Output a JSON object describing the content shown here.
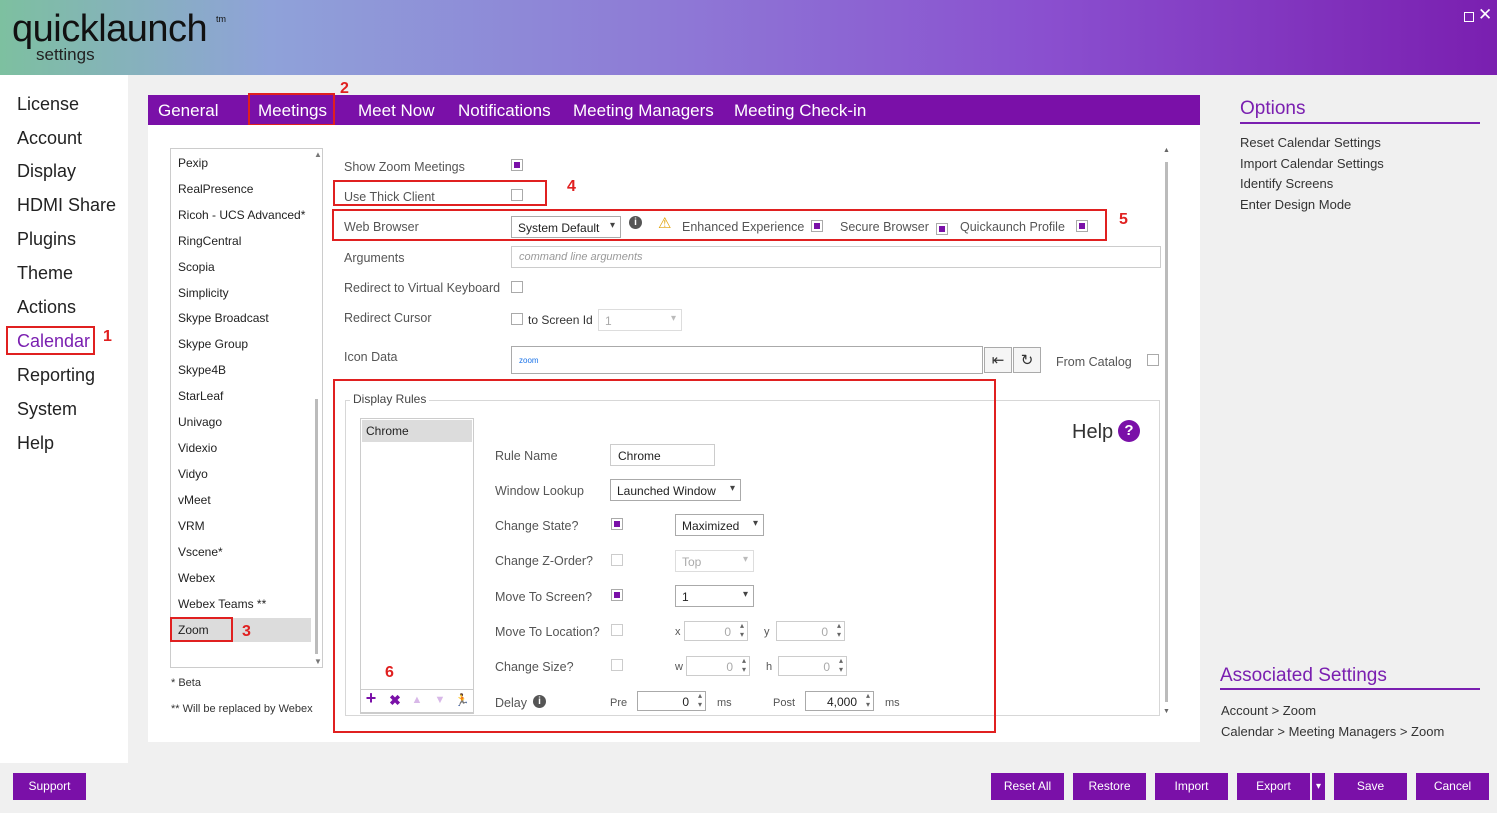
{
  "app": {
    "logo": "quicklaunch",
    "logo_tm": "tm",
    "logo_sub": "settings"
  },
  "window": {
    "maximize_icon": "maximize-icon",
    "close_icon": "close-icon",
    "close_glyph": "✕"
  },
  "nav": {
    "items": [
      {
        "label": "License"
      },
      {
        "label": "Account"
      },
      {
        "label": "Display"
      },
      {
        "label": "HDMI Share"
      },
      {
        "label": "Plugins"
      },
      {
        "label": "Theme"
      },
      {
        "label": "Actions"
      },
      {
        "label": "Calendar"
      },
      {
        "label": "Reporting"
      },
      {
        "label": "System"
      },
      {
        "label": "Help"
      }
    ],
    "active": "Calendar"
  },
  "tabs": [
    {
      "label": "General"
    },
    {
      "label": "Meetings"
    },
    {
      "label": "Meet Now"
    },
    {
      "label": "Notifications"
    },
    {
      "label": "Meeting Managers"
    },
    {
      "label": "Meeting Check-in"
    }
  ],
  "providers": {
    "items": [
      "Pexip",
      "RealPresence",
      "Ricoh - UCS Advanced*",
      "RingCentral",
      "Scopia",
      "Simplicity",
      "Skype Broadcast",
      "Skype Group",
      "Skype4B",
      "StarLeaf",
      "Univago",
      "Videxio",
      "Vidyo",
      "vMeet",
      "VRM",
      "Vscene*",
      "Webex",
      "Webex Teams **",
      "Zoom"
    ],
    "selected": "Zoom",
    "notes": {
      "beta": "* Beta",
      "replaced": "** Will be replaced by Webex"
    }
  },
  "form": {
    "show_zoom_meetings": {
      "label": "Show Zoom Meetings",
      "checked": true
    },
    "use_thick_client": {
      "label": "Use Thick Client",
      "checked": false
    },
    "web_browser": {
      "label": "Web Browser",
      "value": "System Default"
    },
    "enhanced_experience": {
      "label": "Enhanced Experience",
      "checked": true
    },
    "secure_browser": {
      "label": "Secure Browser",
      "checked": true
    },
    "quicklaunch_profile": {
      "label": "Quickaunch Profile",
      "checked": true
    },
    "arguments": {
      "label": "Arguments",
      "placeholder": "command line arguments"
    },
    "redirect_keyboard": {
      "label": "Redirect to Virtual Keyboard",
      "checked": false
    },
    "redirect_cursor": {
      "label": "Redirect Cursor",
      "to_screen_label": "to Screen Id",
      "screen_value": "1"
    },
    "icon_data": {
      "label": "Icon Data",
      "value": "zoom"
    },
    "from_catalog": {
      "label": "From Catalog",
      "checked": false
    }
  },
  "display_rules": {
    "title": "Display Rules",
    "rules": [
      "Chrome"
    ],
    "rule_name": {
      "label": "Rule Name",
      "value": "Chrome"
    },
    "window_lookup": {
      "label": "Window Lookup",
      "value": "Launched Window"
    },
    "change_state": {
      "label": "Change State?",
      "checked": true,
      "value": "Maximized"
    },
    "change_z": {
      "label": "Change Z-Order?",
      "checked": false,
      "value": "Top"
    },
    "move_screen": {
      "label": "Move To Screen?",
      "checked": true,
      "value": "1"
    },
    "move_location": {
      "label": "Move To Location?",
      "checked": false,
      "x_label": "x",
      "x": "0",
      "y_label": "y",
      "y": "0"
    },
    "change_size": {
      "label": "Change Size?",
      "checked": false,
      "w_label": "w",
      "w": "0",
      "h_label": "h",
      "h": "0"
    },
    "delay": {
      "label": "Delay",
      "pre_label": "Pre",
      "pre": "0",
      "post_label": "Post",
      "post": "4,000",
      "unit": "ms"
    },
    "tools": {
      "add": "+",
      "remove": "✖",
      "up": "▲",
      "down": "▼",
      "run": "🏃"
    }
  },
  "help": {
    "label": "Help",
    "glyph": "?"
  },
  "options": {
    "title": "Options",
    "items": [
      "Reset Calendar Settings",
      "Import Calendar Settings",
      "Identify Screens",
      "Enter Design Mode"
    ]
  },
  "associated": {
    "title": "Associated Settings",
    "items": [
      "Account > Zoom",
      "Calendar > Meeting Managers > Zoom"
    ]
  },
  "annotations": [
    "1",
    "2",
    "3",
    "4",
    "5",
    "6"
  ],
  "buttons": {
    "support": "Support",
    "reset_all": "Reset All",
    "restore": "Restore",
    "import": "Import",
    "export": "Export",
    "export_menu": "▾",
    "save": "Save",
    "cancel": "Cancel"
  },
  "colors": {
    "accent": "#7a10a8",
    "annotation": "#e02020"
  }
}
